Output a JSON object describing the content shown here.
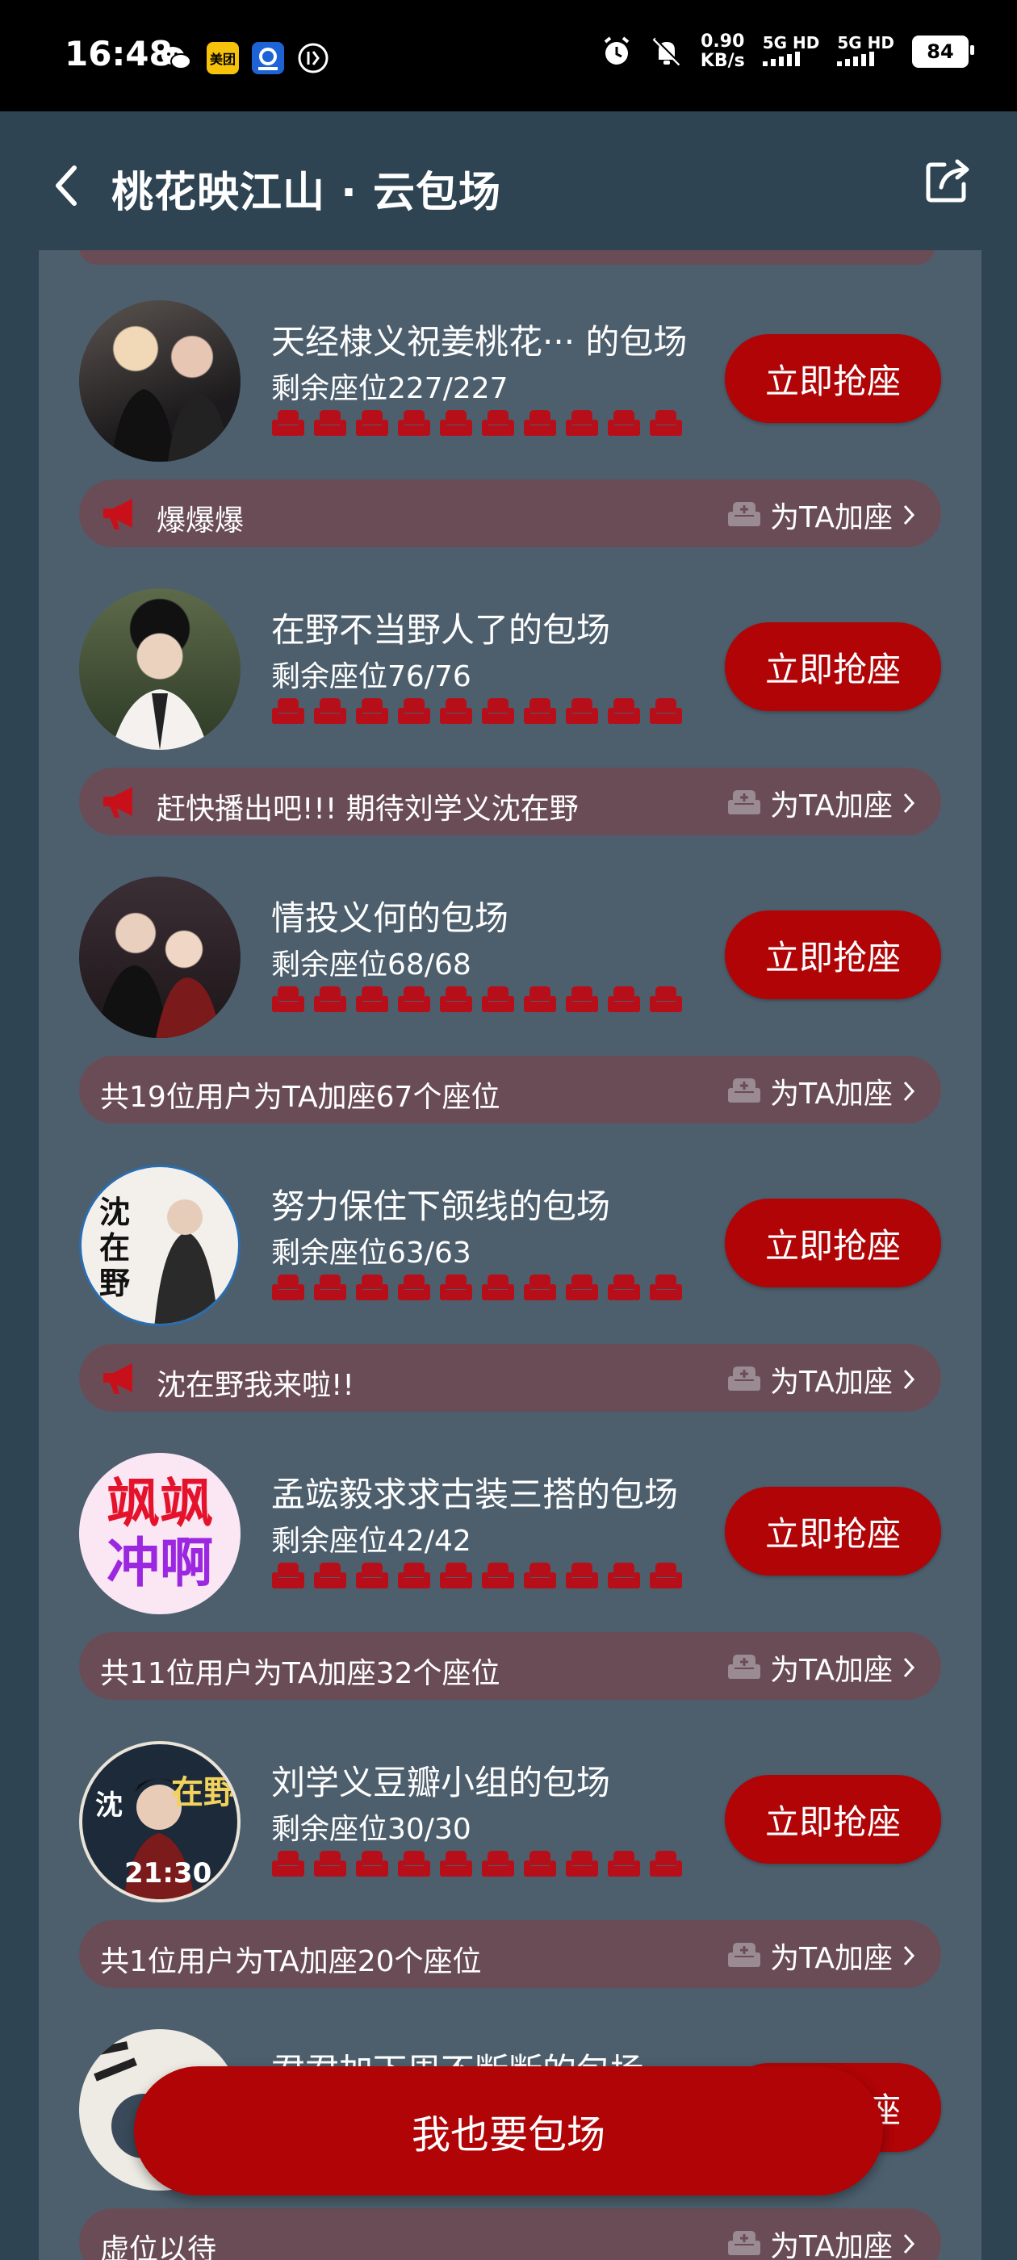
{
  "status_bar": {
    "time": "16:48",
    "speed_value": "0.90",
    "speed_unit": "KB/s",
    "sim1": "5G HD",
    "sim2": "5G HD",
    "battery": "84",
    "app_icons": [
      "wechat-icon",
      "meituan-icon",
      "browser-icon",
      "vpn-icon"
    ],
    "meituan_label": "美团"
  },
  "header": {
    "title": "桃花映江山 · 云包场"
  },
  "colors": {
    "background": "#2e4452",
    "panel": "#4d5f6d",
    "accent_red": "#b00407",
    "seat_red": "#b70f19",
    "message_bar": "#6a4c56"
  },
  "labels": {
    "grab_button": "立即抢座",
    "add_seat": "为TA加座",
    "float_button": "我也要包场"
  },
  "entries": [
    {
      "title": "天经棣义祝姜桃花··· 的包场",
      "seats": "剩余座位227/227",
      "message": "爆爆爆",
      "message_type": "announcement"
    },
    {
      "title": "在野不当野人了的包场",
      "seats": "剩余座位76/76",
      "message": "赶快播出吧!!!  期待刘学义沈在野",
      "message_type": "announcement"
    },
    {
      "title": "情投义何的包场",
      "seats": "剩余座位68/68",
      "message": "共19位用户为TA加座67个座位",
      "message_type": "summary"
    },
    {
      "title": "努力保住下颌线的包场",
      "seats": "剩余座位63/63",
      "message": "沈在野我来啦!!",
      "message_type": "announcement",
      "avatar_text": [
        "沈",
        "在",
        "野"
      ]
    },
    {
      "title": "孟竤毅求求古装三搭的包场",
      "seats": "剩余座位42/42",
      "message": "共11位用户为TA加座32个座位",
      "message_type": "summary",
      "avatar_text": [
        "飒飒",
        "冲啊"
      ]
    },
    {
      "title": "刘学义豆瓣小组的包场",
      "seats": "剩余座位30/30",
      "message": "共1位用户为TA加座20个座位",
      "message_type": "summary",
      "avatar_text": [
        "沈",
        "在野",
        "21:30"
      ]
    },
    {
      "title": "君君加下周不断断的包场",
      "seats": "",
      "message": "虚位以待",
      "message_type": "summary"
    }
  ]
}
